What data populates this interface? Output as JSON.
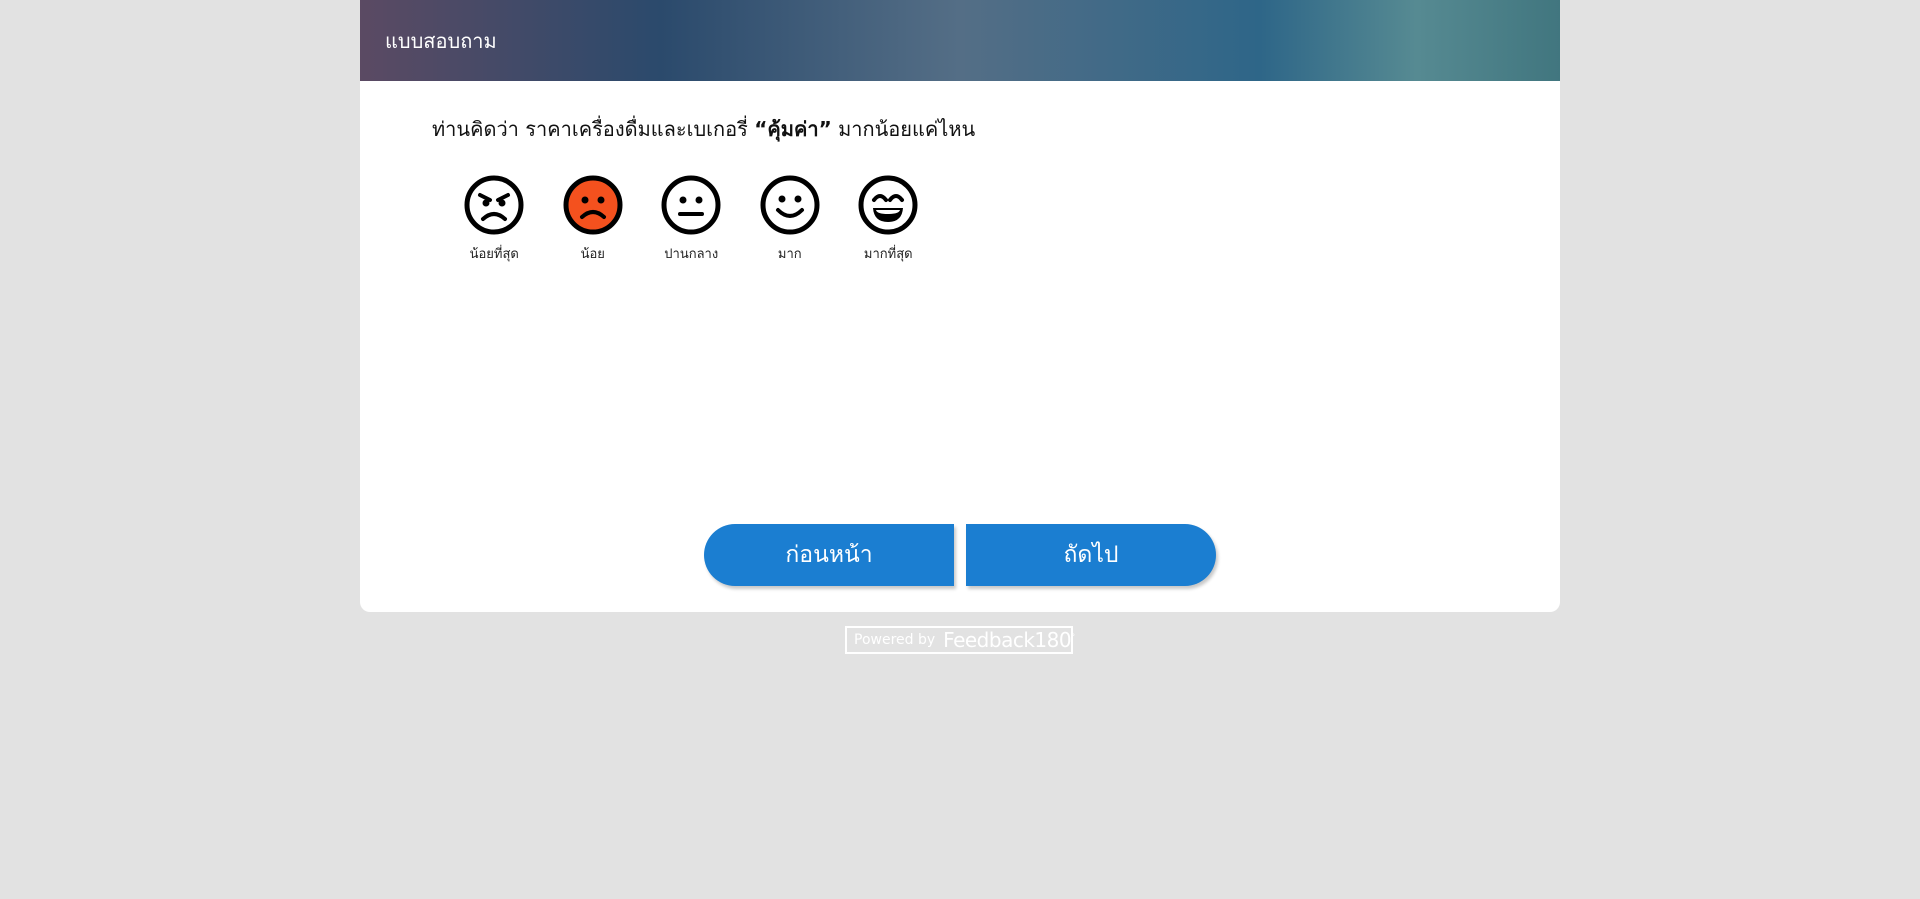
{
  "header": {
    "title": "แบบสอบถาม"
  },
  "question": {
    "prefix": "ท่านคิดว่า ราคาเครื่องดื่มและเบเกอรี่ ",
    "emphasis": "“คุ้มค่า”",
    "suffix": " มากน้อยแค่ไหน"
  },
  "rating": {
    "selected_index": 1,
    "selected_color": "#f4511e",
    "options": [
      {
        "label": "น้อยที่สุด",
        "icon": "angry-face-icon",
        "selected": false
      },
      {
        "label": "น้อย",
        "icon": "sad-face-icon",
        "selected": true
      },
      {
        "label": "ปานกลาง",
        "icon": "neutral-face-icon",
        "selected": false
      },
      {
        "label": "มาก",
        "icon": "smile-face-icon",
        "selected": false
      },
      {
        "label": "มากที่สุด",
        "icon": "grin-face-icon",
        "selected": false
      }
    ]
  },
  "nav": {
    "prev_label": "ก่อนหน้า",
    "next_label": "ถัดไป",
    "button_color": "#1b7ed1"
  },
  "footer": {
    "powered_by": "Powered by",
    "brand": "Feedback180",
    "brand_mark": "°"
  }
}
